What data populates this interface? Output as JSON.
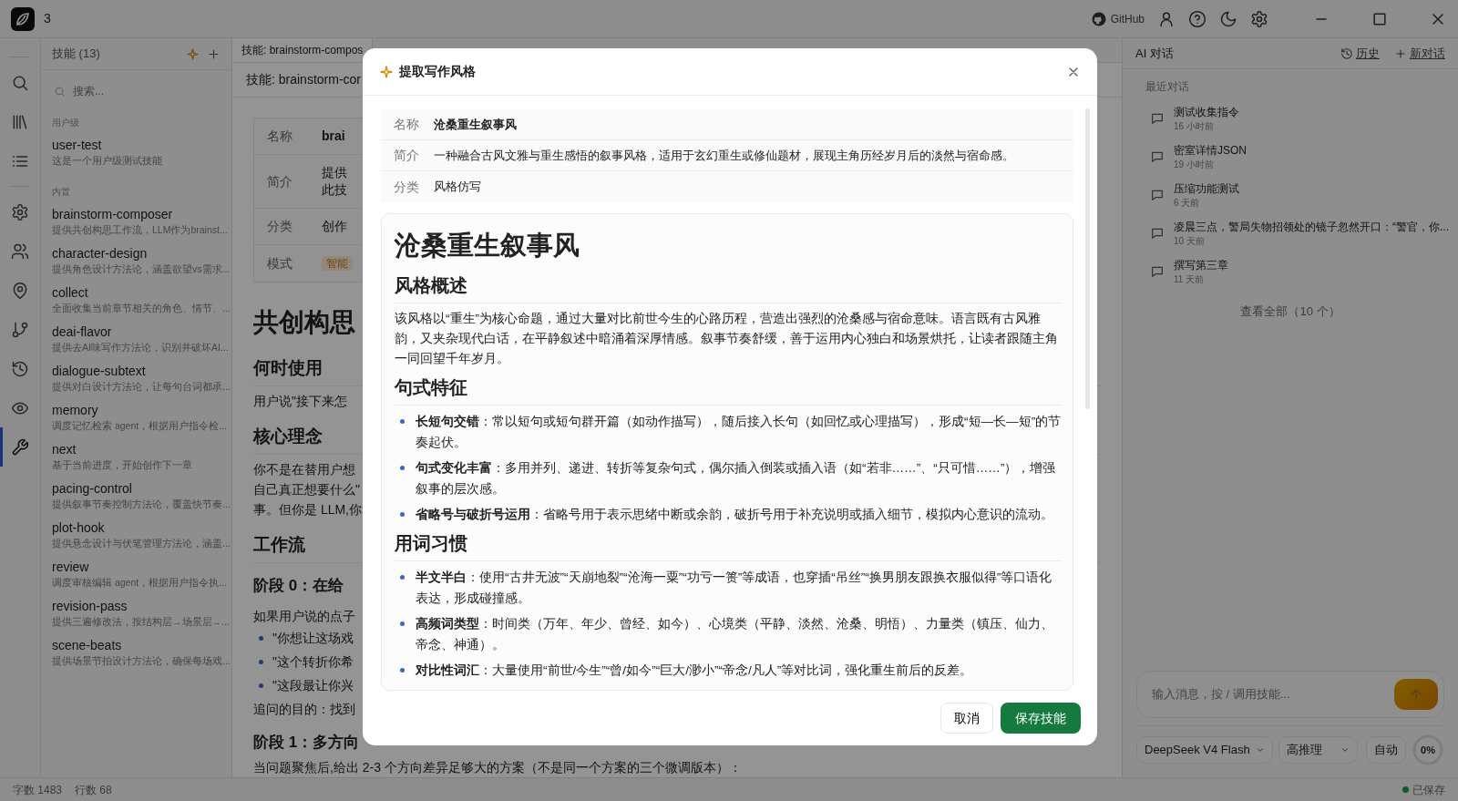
{
  "title_bar": {
    "project": "3",
    "github_label": "GitHub",
    "actions": [
      {
        "kind": "user"
      },
      {
        "kind": "help"
      },
      {
        "kind": "moon"
      },
      {
        "kind": "gear"
      }
    ]
  },
  "rail_groups": [
    {
      "items": [
        {
          "kind": "search",
          "selected": false
        },
        {
          "kind": "books",
          "selected": false
        },
        {
          "kind": "list",
          "selected": false
        }
      ]
    },
    {
      "items": [
        {
          "kind": "gear",
          "selected": false
        },
        {
          "kind": "users",
          "selected": false
        },
        {
          "kind": "pin",
          "selected": false
        },
        {
          "kind": "branch",
          "selected": false
        },
        {
          "kind": "history",
          "selected": false
        },
        {
          "kind": "eye",
          "selected": false
        },
        {
          "kind": "wrench",
          "selected": true
        }
      ]
    }
  ],
  "skills_panel": {
    "title": "技能 (13)",
    "search_placeholder": "搜索...",
    "groups": [
      {
        "label": "用户级",
        "items": [
          {
            "name": "user-test",
            "description": "这是一个用户级测试技能"
          }
        ]
      },
      {
        "label": "内置",
        "items": [
          {
            "name": "brainstorm-composer",
            "description": "提供共创构思工作流，LLM作为brainst..."
          },
          {
            "name": "character-design",
            "description": "提供角色设计方法论，涵盖欲望vs需求..."
          },
          {
            "name": "collect",
            "description": "全面收集当前章节相关的角色、情节、..."
          },
          {
            "name": "deai-flavor",
            "description": "提供去AI味写作方法论，识别并破坏AI..."
          },
          {
            "name": "dialogue-subtext",
            "description": "提供对白设计方法论，让每句台词都承..."
          },
          {
            "name": "memory",
            "description": "调度记忆检索 agent，根据用户指令检..."
          },
          {
            "name": "next",
            "description": "基于当前进度，开始创作下一章"
          },
          {
            "name": "pacing-control",
            "description": "提供叙事节奏控制方法论，覆盖快节奏..."
          },
          {
            "name": "plot-hook",
            "description": "提供悬念设计与伏笔管理方法论，涵盖..."
          },
          {
            "name": "review",
            "description": "调度审核编辑 agent，根据用户指令执..."
          },
          {
            "name": "revision-pass",
            "description": "提供三遍修改法，按结构层→场景层→..."
          },
          {
            "name": "scene-beats",
            "description": "提供场景节拍设计方法论，确保每场戏..."
          }
        ]
      }
    ]
  },
  "editor": {
    "tab": "技能: brainstorm-compos",
    "header": "技能: brainstorm-cor",
    "meta": [
      {
        "label": "名称",
        "kind": "bold",
        "lines": [
          "brai"
        ]
      },
      {
        "label": "简介",
        "kind": "text",
        "lines": [
          "提供",
          "此技"
        ]
      },
      {
        "label": "分类",
        "kind": "text",
        "lines": [
          "创作"
        ]
      },
      {
        "label": "模式",
        "kind": "badge",
        "lines": [
          "智能"
        ]
      }
    ],
    "blocks": [
      {
        "kind": "h1",
        "text": "共创构思"
      },
      {
        "kind": "h2",
        "text": "何时使用"
      },
      {
        "kind": "p",
        "text": "用户说\"接下来怎"
      },
      {
        "kind": "h2",
        "text": "核心理念"
      },
      {
        "kind": "p",
        "text": "你不是在替用户想"
      },
      {
        "kind": "p",
        "text": "自己真正想要什么\""
      },
      {
        "kind": "p",
        "text": "事。但你是 LLM,你"
      },
      {
        "kind": "h2",
        "text": "工作流"
      },
      {
        "kind": "h3",
        "text": "阶段 0：在给"
      },
      {
        "kind": "p",
        "text": "如果用户说的点子"
      },
      {
        "kind": "li",
        "text": "\"你想让这场戏"
      },
      {
        "kind": "li",
        "text": "\"这个转折你希"
      },
      {
        "kind": "li",
        "text": "\"这段最让你兴"
      },
      {
        "kind": "p",
        "text": "追问的目的：找到"
      },
      {
        "kind": "h3",
        "text": "阶段 1：多方向"
      },
      {
        "kind": "p",
        "text": "当问题聚焦后,给出 2-3 个方向差异足够大的方案（不是同一个方案的三个微调版本）："
      }
    ]
  },
  "modal": {
    "title": "提取写作风格",
    "fields": [
      {
        "label": "名称",
        "kind": "bold",
        "value": "沧桑重生叙事风"
      },
      {
        "label": "简介",
        "kind": "text",
        "value": "一种融合古风文雅与重生感悟的叙事风格，适用于玄幻重生或修仙题材，展现主角历经岁月后的淡然与宿命感。"
      },
      {
        "label": "分类",
        "kind": "text",
        "value": "风格仿写"
      }
    ],
    "preview": [
      {
        "kind": "h1",
        "text": "沧桑重生叙事风"
      },
      {
        "kind": "h2",
        "text": "风格概述"
      },
      {
        "kind": "p",
        "text": "该风格以“重生”为核心命题，通过大量对比前世今生的心路历程，营造出强烈的沧桑感与宿命意味。语言既有古风雅韵，又夹杂现代白话，在平静叙述中暗涌着深厚情感。叙事节奏舒缓，善于运用内心独白和场景烘托，让读者跟随主角一同回望千年岁月。"
      },
      {
        "kind": "h2",
        "text": "句式特征"
      },
      {
        "kind": "li",
        "text": "**长短句交错**：常以短句或短句群开篇（如动作描写），随后接入长句（如回忆或心理描写），形成“短—长—短”的节奏起伏。"
      },
      {
        "kind": "li",
        "text": "**句式变化丰富**：多用并列、递进、转折等复杂句式，偶尔插入倒装或插入语（如“若非……”、“只可惜……”），增强叙事的层次感。"
      },
      {
        "kind": "li",
        "text": "**省略号与破折号运用**：省略号用于表示思绪中断或余韵，破折号用于补充说明或插入细节，模拟内心意识的流动。"
      },
      {
        "kind": "h2",
        "text": "用词习惯"
      },
      {
        "kind": "li",
        "text": "**半文半白**：使用“古井无波”“天崩地裂”“沧海一粟”“功亏一篑”等成语，也穿插“吊丝”“换男朋友跟换衣服似得”等口语化表达，形成碰撞感。"
      },
      {
        "kind": "li",
        "text": "**高频词类型**：时间类（万年、年少、曾经、如今）、心境类（平静、淡然、沧桑、明悟）、力量类（镇压、仙力、帝念、神通）。"
      },
      {
        "kind": "li",
        "text": "**对比性词汇**：大量使用“前世/今生”“曾/如今”“巨大/渺小”“帝念/凡人”等对比词，强化重生前后的反差。"
      }
    ],
    "buttons": [
      {
        "label": "取消",
        "kind": "secondary"
      },
      {
        "label": "保存技能",
        "kind": "primary"
      }
    ]
  },
  "chat": {
    "title": "AI 对话",
    "history": "历史",
    "new_chat": "新对话",
    "recent_label": "最近对话",
    "conversations": [
      {
        "title": "测试收集指令",
        "time": "16 小时前"
      },
      {
        "title": "密室详情JSON",
        "time": "19 小时前"
      },
      {
        "title": "压缩功能测试",
        "time": "6 天前"
      },
      {
        "title": "凌晨三点，警局失物招领处的镜子忽然开口：“警官，你...",
        "time": "10 天前"
      },
      {
        "title": "撰写第三章",
        "time": "11 天前"
      }
    ],
    "view_all": "查看全部（10 个）",
    "input_placeholder": "输入消息，按 / 调用技能...",
    "model": "DeepSeek V4 Flash",
    "reasoning": "高推理",
    "mode": "自动",
    "context": {
      "reading": "0%",
      "level": 0
    }
  },
  "status_bar": {
    "words": "字数 1483",
    "lines": "行数 68",
    "save_state": "已保存"
  }
}
